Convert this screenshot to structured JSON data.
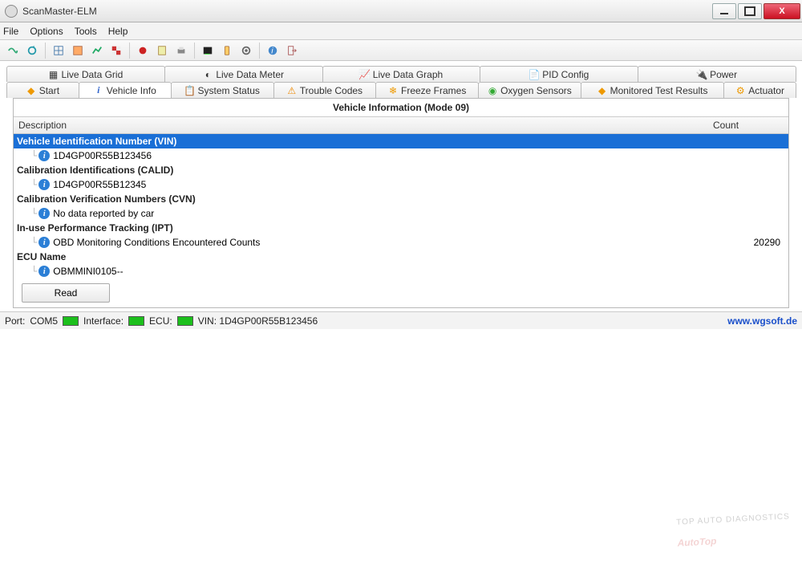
{
  "window": {
    "title": "ScanMaster-ELM"
  },
  "menu": {
    "file": "File",
    "options": "Options",
    "tools": "Tools",
    "help": "Help"
  },
  "tabs_top": {
    "grid": "Live Data Grid",
    "meter": "Live Data Meter",
    "graph": "Live Data Graph",
    "pid": "PID Config",
    "power": "Power"
  },
  "tabs_bottom": {
    "start": "Start",
    "vehicle": "Vehicle Info",
    "system": "System Status",
    "trouble": "Trouble Codes",
    "freeze": "Freeze Frames",
    "oxygen": "Oxygen Sensors",
    "monitored": "Monitored Test Results",
    "actuator": "Actuator"
  },
  "panel": {
    "title": "Vehicle Information (Mode 09)",
    "col_desc": "Description",
    "col_count": "Count"
  },
  "rows": {
    "vin_group": "Vehicle Identification Number (VIN)",
    "vin_value": "1D4GP00R55B123456",
    "calid_group": "Calibration Identifications (CALID)",
    "calid_value": "1D4GP00R55B12345",
    "cvn_group": "Calibration Verification Numbers (CVN)",
    "cvn_value": "No data reported by car",
    "ipt_group": "In-use Performance Tracking (IPT)",
    "ipt_value": "OBD Monitoring Conditions Encountered Counts",
    "ipt_count": "20290",
    "ecu_group": "ECU Name",
    "ecu_value": "OBMMINI0105--"
  },
  "buttons": {
    "read": "Read"
  },
  "status": {
    "port_lbl": "Port:",
    "port_val": "COM5",
    "iface_lbl": "Interface:",
    "ecu_lbl": "ECU:",
    "vin_lbl": "VIN: 1D4GP00R55B123456",
    "link": "www.wgsoft.de"
  },
  "watermark": {
    "main": "AutoTop",
    "sub": "TOP AUTO DIAGNOSTICS"
  }
}
